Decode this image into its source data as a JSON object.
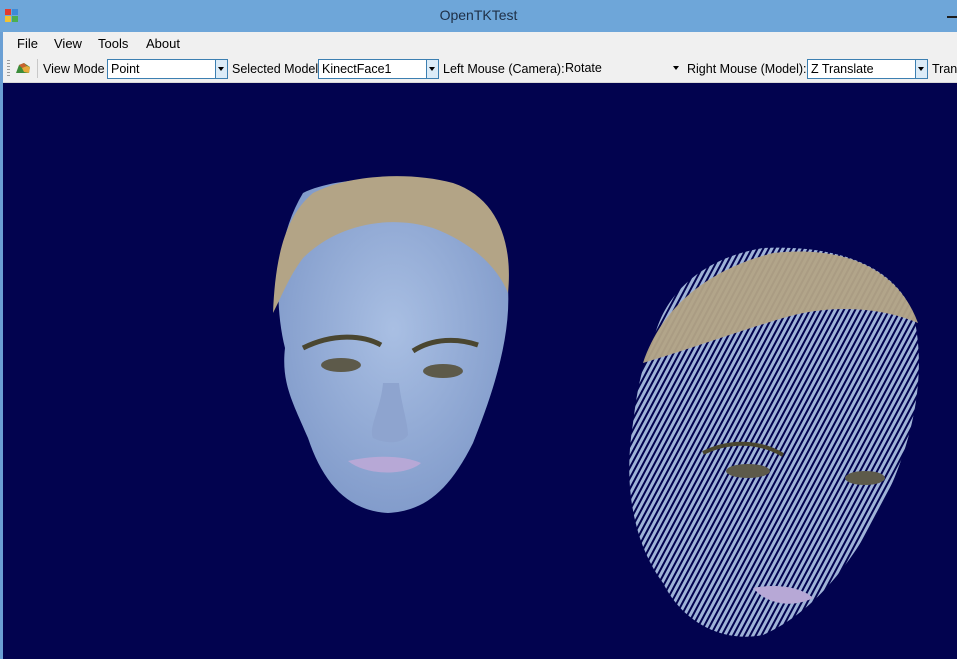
{
  "window": {
    "title": "OpenTKTest",
    "app_icon": "app-icon",
    "control_icon": "minimize-icon"
  },
  "menu": {
    "items": [
      {
        "label": "File"
      },
      {
        "label": "View"
      },
      {
        "label": "Tools"
      },
      {
        "label": "About"
      }
    ]
  },
  "toolbar": {
    "icon": "model-icon",
    "view_mode_label": "View Mode",
    "view_mode_value": "Point",
    "selected_model_label": "Selected Model",
    "selected_model_value": "KinectFace1",
    "left_mouse_label": "Left Mouse (Camera):",
    "left_mouse_value": "Rotate",
    "right_mouse_label": "Right Mouse (Model):",
    "right_mouse_value": "Z Translate",
    "overflow_label": "Trans"
  },
  "viewport": {
    "background": "#02034f",
    "content": "two point-cloud face models"
  },
  "colors": {
    "titlebar": "#6ea6d9",
    "chrome": "#f0f0f0",
    "combo_border": "#3c7fb1"
  }
}
